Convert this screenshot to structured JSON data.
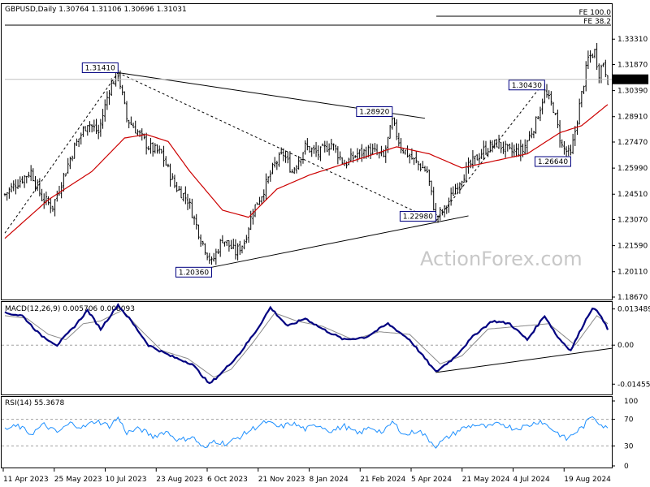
{
  "chart_data": [
    {
      "panel": "price",
      "type": "ohlc",
      "title": "GBPUSD,Daily  1.30764 1.31106 1.30696 1.31031",
      "symbol": "GBPUSD",
      "timeframe": "Daily",
      "ohlc_readout": [
        "1.30764",
        "1.31106",
        "1.30696",
        "1.31031"
      ],
      "last_price": "1.31031",
      "y_ticks": [
        "1.33310",
        "1.31870",
        "1.30390",
        "1.28910",
        "1.27470",
        "1.25990",
        "1.24510",
        "1.23070",
        "1.21590",
        "1.20110",
        "1.18670"
      ],
      "ylim": [
        1.1867,
        1.3415
      ],
      "x_ticks": [
        "11 Apr 2023",
        "25 May 2023",
        "10 Jul 2023",
        "23 Aug 2023",
        "6 Oct 2023",
        "21 Nov 2023",
        "8 Jan 2024",
        "21 Feb 2024",
        "5 Apr 2024",
        "21 May 2024",
        "4 Jul 2024",
        "19 Aug 2024"
      ],
      "fib_levels": [
        {
          "label": "FE 100.0",
          "value": 1.3405
        },
        {
          "label": "FE 38.2",
          "value": 1.3365
        }
      ],
      "annotations": [
        {
          "text": "1.31410",
          "value": 1.3141
        },
        {
          "text": "1.28920",
          "value": 1.2892
        },
        {
          "text": "1.30430",
          "value": 1.3043
        },
        {
          "text": "1.26640",
          "value": 1.2664
        },
        {
          "text": "1.22980",
          "value": 1.2298
        },
        {
          "text": "1.20360",
          "value": 1.2036
        }
      ],
      "close_keypoints": [
        {
          "t": 0,
          "v": 1.245
        },
        {
          "t": 6,
          "v": 1.252
        },
        {
          "t": 12,
          "v": 1.258
        },
        {
          "t": 17,
          "v": 1.243
        },
        {
          "t": 22,
          "v": 1.238
        },
        {
          "t": 26,
          "v": 1.252
        },
        {
          "t": 32,
          "v": 1.272
        },
        {
          "t": 38,
          "v": 1.286
        },
        {
          "t": 43,
          "v": 1.28
        },
        {
          "t": 48,
          "v": 1.305
        },
        {
          "t": 52,
          "v": 1.314
        },
        {
          "t": 56,
          "v": 1.288
        },
        {
          "t": 60,
          "v": 1.282
        },
        {
          "t": 66,
          "v": 1.272
        },
        {
          "t": 72,
          "v": 1.268
        },
        {
          "t": 78,
          "v": 1.25
        },
        {
          "t": 84,
          "v": 1.242
        },
        {
          "t": 90,
          "v": 1.22
        },
        {
          "t": 95,
          "v": 1.206
        },
        {
          "t": 100,
          "v": 1.22
        },
        {
          "t": 106,
          "v": 1.212
        },
        {
          "t": 110,
          "v": 1.218
        },
        {
          "t": 114,
          "v": 1.236
        },
        {
          "t": 118,
          "v": 1.245
        },
        {
          "t": 124,
          "v": 1.262
        },
        {
          "t": 128,
          "v": 1.268
        },
        {
          "t": 132,
          "v": 1.258
        },
        {
          "t": 138,
          "v": 1.272
        },
        {
          "t": 144,
          "v": 1.268
        },
        {
          "t": 150,
          "v": 1.274
        },
        {
          "t": 156,
          "v": 1.262
        },
        {
          "t": 162,
          "v": 1.268
        },
        {
          "t": 168,
          "v": 1.27
        },
        {
          "t": 174,
          "v": 1.266
        },
        {
          "t": 178,
          "v": 1.286
        },
        {
          "t": 182,
          "v": 1.272
        },
        {
          "t": 188,
          "v": 1.264
        },
        {
          "t": 194,
          "v": 1.258
        },
        {
          "t": 198,
          "v": 1.232
        },
        {
          "t": 202,
          "v": 1.236
        },
        {
          "t": 208,
          "v": 1.251
        },
        {
          "t": 214,
          "v": 1.262
        },
        {
          "t": 220,
          "v": 1.27
        },
        {
          "t": 226,
          "v": 1.274
        },
        {
          "t": 232,
          "v": 1.269
        },
        {
          "t": 238,
          "v": 1.27
        },
        {
          "t": 244,
          "v": 1.286
        },
        {
          "t": 248,
          "v": 1.303
        },
        {
          "t": 252,
          "v": 1.294
        },
        {
          "t": 256,
          "v": 1.272
        },
        {
          "t": 260,
          "v": 1.267
        },
        {
          "t": 264,
          "v": 1.295
        },
        {
          "t": 268,
          "v": 1.322
        },
        {
          "t": 271,
          "v": 1.326
        },
        {
          "t": 273,
          "v": 1.314
        },
        {
          "t": 275,
          "v": 1.32
        },
        {
          "t": 277,
          "v": 1.3103
        }
      ],
      "ma_keypoints": [
        {
          "t": 0,
          "v": 1.22
        },
        {
          "t": 20,
          "v": 1.242
        },
        {
          "t": 40,
          "v": 1.258
        },
        {
          "t": 55,
          "v": 1.277
        },
        {
          "t": 65,
          "v": 1.279
        },
        {
          "t": 75,
          "v": 1.275
        },
        {
          "t": 85,
          "v": 1.258
        },
        {
          "t": 100,
          "v": 1.236
        },
        {
          "t": 112,
          "v": 1.232
        },
        {
          "t": 125,
          "v": 1.248
        },
        {
          "t": 140,
          "v": 1.256
        },
        {
          "t": 160,
          "v": 1.264
        },
        {
          "t": 180,
          "v": 1.272
        },
        {
          "t": 195,
          "v": 1.268
        },
        {
          "t": 210,
          "v": 1.26
        },
        {
          "t": 225,
          "v": 1.264
        },
        {
          "t": 240,
          "v": 1.268
        },
        {
          "t": 255,
          "v": 1.28
        },
        {
          "t": 265,
          "v": 1.284
        },
        {
          "t": 277,
          "v": 1.296
        }
      ],
      "trendlines": [
        {
          "style": "solid",
          "from": {
            "t": 52,
            "v": 1.3141
          },
          "to": {
            "t": 193,
            "v": 1.2882
          }
        },
        {
          "style": "solid",
          "from": {
            "t": 95,
            "v": 1.2036
          },
          "to": {
            "t": 213,
            "v": 1.2328
          }
        },
        {
          "style": "dashed",
          "from": {
            "t": 0,
            "v": 1.223
          },
          "to": {
            "t": 52,
            "v": 1.3141
          }
        },
        {
          "style": "dashed",
          "from": {
            "t": 52,
            "v": 1.3141
          },
          "to": {
            "t": 198,
            "v": 1.2298
          }
        },
        {
          "style": "dashed",
          "from": {
            "t": 198,
            "v": 1.2298
          },
          "to": {
            "t": 245,
            "v": 1.3043
          }
        }
      ]
    },
    {
      "panel": "macd",
      "type": "line",
      "title": "MACD(12,26,9) 0.005706 0.008093",
      "params": "12,26,9",
      "values_readout": [
        "0.005706",
        "0.008093"
      ],
      "y_ticks": [
        "0.013489",
        "0.00",
        "-0.014554"
      ],
      "ylim": [
        -0.0175,
        0.0152
      ],
      "macd_keypoints": [
        {
          "t": 0,
          "v": 0.012
        },
        {
          "t": 8,
          "v": 0.011
        },
        {
          "t": 16,
          "v": 0.004
        },
        {
          "t": 24,
          "v": 0.0
        },
        {
          "t": 32,
          "v": 0.007
        },
        {
          "t": 38,
          "v": 0.013
        },
        {
          "t": 44,
          "v": 0.006
        },
        {
          "t": 52,
          "v": 0.015
        },
        {
          "t": 58,
          "v": 0.009
        },
        {
          "t": 66,
          "v": 0.0
        },
        {
          "t": 76,
          "v": -0.004
        },
        {
          "t": 86,
          "v": -0.007
        },
        {
          "t": 94,
          "v": -0.0145
        },
        {
          "t": 100,
          "v": -0.01
        },
        {
          "t": 108,
          "v": -0.003
        },
        {
          "t": 116,
          "v": 0.006
        },
        {
          "t": 122,
          "v": 0.014
        },
        {
          "t": 130,
          "v": 0.007
        },
        {
          "t": 138,
          "v": 0.01
        },
        {
          "t": 146,
          "v": 0.006
        },
        {
          "t": 156,
          "v": 0.002
        },
        {
          "t": 166,
          "v": 0.003
        },
        {
          "t": 176,
          "v": 0.008
        },
        {
          "t": 186,
          "v": 0.002
        },
        {
          "t": 198,
          "v": -0.01
        },
        {
          "t": 206,
          "v": -0.005
        },
        {
          "t": 216,
          "v": 0.004
        },
        {
          "t": 224,
          "v": 0.009
        },
        {
          "t": 232,
          "v": 0.008
        },
        {
          "t": 240,
          "v": 0.002
        },
        {
          "t": 248,
          "v": 0.011
        },
        {
          "t": 254,
          "v": 0.003
        },
        {
          "t": 260,
          "v": -0.002
        },
        {
          "t": 266,
          "v": 0.008
        },
        {
          "t": 270,
          "v": 0.014
        },
        {
          "t": 274,
          "v": 0.011
        },
        {
          "t": 277,
          "v": 0.0057
        }
      ],
      "signal_keypoints": [
        {
          "t": 0,
          "v": 0.011
        },
        {
          "t": 10,
          "v": 0.01
        },
        {
          "t": 20,
          "v": 0.004
        },
        {
          "t": 28,
          "v": 0.002
        },
        {
          "t": 36,
          "v": 0.008
        },
        {
          "t": 44,
          "v": 0.009
        },
        {
          "t": 54,
          "v": 0.013
        },
        {
          "t": 62,
          "v": 0.006
        },
        {
          "t": 72,
          "v": -0.002
        },
        {
          "t": 84,
          "v": -0.005
        },
        {
          "t": 96,
          "v": -0.012
        },
        {
          "t": 104,
          "v": -0.009
        },
        {
          "t": 114,
          "v": 0.001
        },
        {
          "t": 124,
          "v": 0.012
        },
        {
          "t": 134,
          "v": 0.009
        },
        {
          "t": 146,
          "v": 0.007
        },
        {
          "t": 160,
          "v": 0.002
        },
        {
          "t": 172,
          "v": 0.005
        },
        {
          "t": 186,
          "v": 0.004
        },
        {
          "t": 200,
          "v": -0.007
        },
        {
          "t": 210,
          "v": -0.004
        },
        {
          "t": 222,
          "v": 0.006
        },
        {
          "t": 236,
          "v": 0.007
        },
        {
          "t": 250,
          "v": 0.008
        },
        {
          "t": 262,
          "v": 0.0
        },
        {
          "t": 272,
          "v": 0.011
        },
        {
          "t": 277,
          "v": 0.008
        }
      ],
      "trendlines": [
        {
          "style": "solid",
          "from": {
            "t": 198,
            "v": -0.0102
          },
          "to": {
            "t": 277,
            "v": -0.0012
          }
        }
      ]
    },
    {
      "panel": "rsi",
      "type": "line",
      "title": "RSI(14) 55.3678",
      "period": 14,
      "value_readout": "55.3678",
      "y_ticks": [
        "100",
        "70",
        "30",
        "0"
      ],
      "ylim": [
        0,
        100
      ],
      "rsi_keypoints": [
        {
          "t": 0,
          "v": 55
        },
        {
          "t": 6,
          "v": 60
        },
        {
          "t": 12,
          "v": 48
        },
        {
          "t": 18,
          "v": 62
        },
        {
          "t": 24,
          "v": 50
        },
        {
          "t": 30,
          "v": 64
        },
        {
          "t": 36,
          "v": 58
        },
        {
          "t": 42,
          "v": 68
        },
        {
          "t": 48,
          "v": 60
        },
        {
          "t": 52,
          "v": 72
        },
        {
          "t": 56,
          "v": 50
        },
        {
          "t": 62,
          "v": 56
        },
        {
          "t": 68,
          "v": 44
        },
        {
          "t": 74,
          "v": 52
        },
        {
          "t": 80,
          "v": 38
        },
        {
          "t": 86,
          "v": 44
        },
        {
          "t": 92,
          "v": 25
        },
        {
          "t": 96,
          "v": 38
        },
        {
          "t": 102,
          "v": 33
        },
        {
          "t": 108,
          "v": 44
        },
        {
          "t": 114,
          "v": 56
        },
        {
          "t": 120,
          "v": 66
        },
        {
          "t": 126,
          "v": 58
        },
        {
          "t": 132,
          "v": 64
        },
        {
          "t": 138,
          "v": 55
        },
        {
          "t": 144,
          "v": 62
        },
        {
          "t": 150,
          "v": 52
        },
        {
          "t": 156,
          "v": 60
        },
        {
          "t": 162,
          "v": 48
        },
        {
          "t": 168,
          "v": 58
        },
        {
          "t": 174,
          "v": 50
        },
        {
          "t": 178,
          "v": 66
        },
        {
          "t": 184,
          "v": 46
        },
        {
          "t": 190,
          "v": 54
        },
        {
          "t": 198,
          "v": 30
        },
        {
          "t": 204,
          "v": 44
        },
        {
          "t": 210,
          "v": 56
        },
        {
          "t": 216,
          "v": 62
        },
        {
          "t": 222,
          "v": 58
        },
        {
          "t": 228,
          "v": 64
        },
        {
          "t": 234,
          "v": 56
        },
        {
          "t": 240,
          "v": 60
        },
        {
          "t": 246,
          "v": 68
        },
        {
          "t": 252,
          "v": 54
        },
        {
          "t": 258,
          "v": 40
        },
        {
          "t": 262,
          "v": 50
        },
        {
          "t": 266,
          "v": 60
        },
        {
          "t": 270,
          "v": 76
        },
        {
          "t": 274,
          "v": 62
        },
        {
          "t": 277,
          "v": 55.37
        }
      ]
    }
  ],
  "watermark": "ActionForex.com",
  "colors": {
    "price_bars": "#000000",
    "ma": "#cc0000",
    "macd": "#000080",
    "signal": "#8a8a8a",
    "rsi": "#1e90ff",
    "last_price_tag_bg": "#000000",
    "last_price_tag_text": "#ffffff",
    "annotation_box_border": "#000080",
    "annotation_text": "#000080",
    "grid_dashed": "#a0a0a0",
    "panel_border": "#000000"
  }
}
